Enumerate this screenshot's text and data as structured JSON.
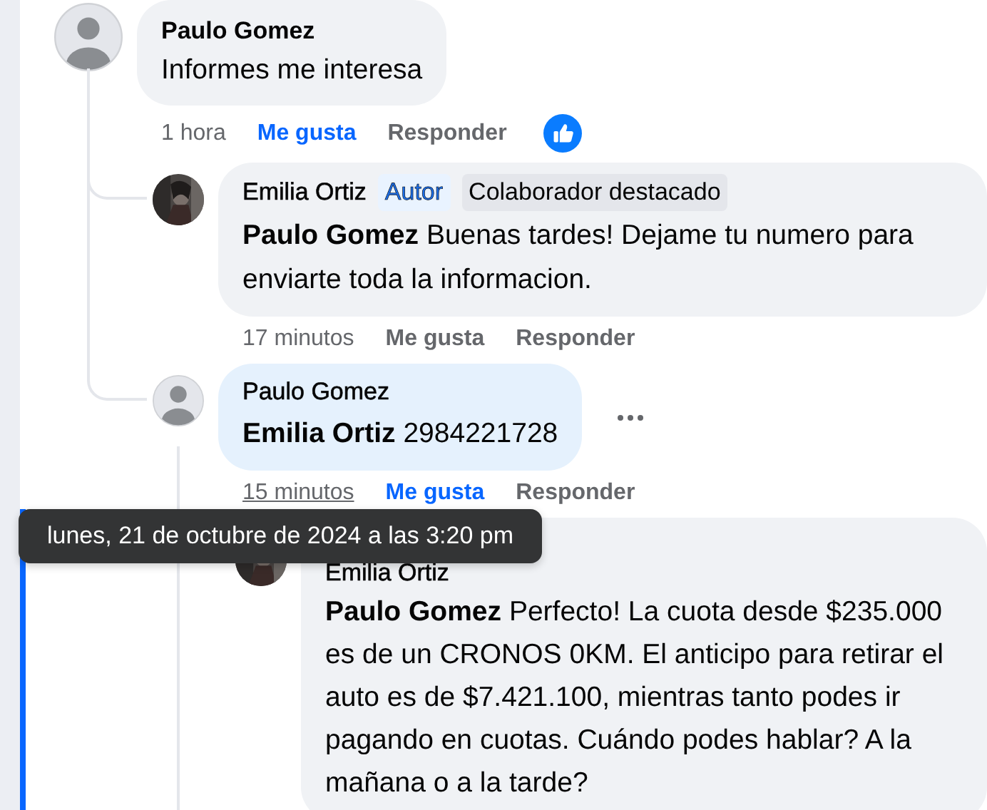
{
  "comments": [
    {
      "author": "Paulo Gomez",
      "avatar": {
        "kind": "default"
      },
      "text": "Informes me interesa",
      "time": "1 hora",
      "like_label": "Me gusta",
      "liked": true,
      "reply_label": "Responder",
      "reactions": [
        {
          "kind": "like"
        }
      ],
      "children": [
        {
          "author": "Emilia Ortiz",
          "badges": [
            {
              "label": "Autor",
              "kind": "author"
            },
            {
              "label": "Colaborador destacado",
              "kind": "contributor"
            }
          ],
          "text": "**Paulo Gomez** Buenas tardes! Dejame tu numero para enviarte toda la informacion.",
          "time": "17 minutos",
          "like_label": "Me gusta",
          "liked": false,
          "reply_label": "Responder"
        },
        {
          "author": "Paulo Gomez",
          "avatar": {
            "kind": "default"
          },
          "highlighted": true,
          "menu": true,
          "text": "**Emilia Ortiz** 2984221728",
          "time": "15 minutos",
          "time_hovered": true,
          "time_tooltip": "lunes, 21 de octubre de 2024 a las 3:20 pm",
          "like_label": "Me gusta",
          "liked": true,
          "reply_label": "Responder",
          "children": [
            {
              "author": "Emilia Ortiz",
              "focused": true,
              "text": "**Paulo Gomez** Perfecto! La cuota desde $235.000 es de un CRONOS 0KM. El anticipo para retirar el auto es de $7.421.100, mientras tanto podes ir pagando en cuotas. Cuándo podes hablar? A la mañana o a la tarde?"
            }
          ]
        }
      ]
    }
  ]
}
